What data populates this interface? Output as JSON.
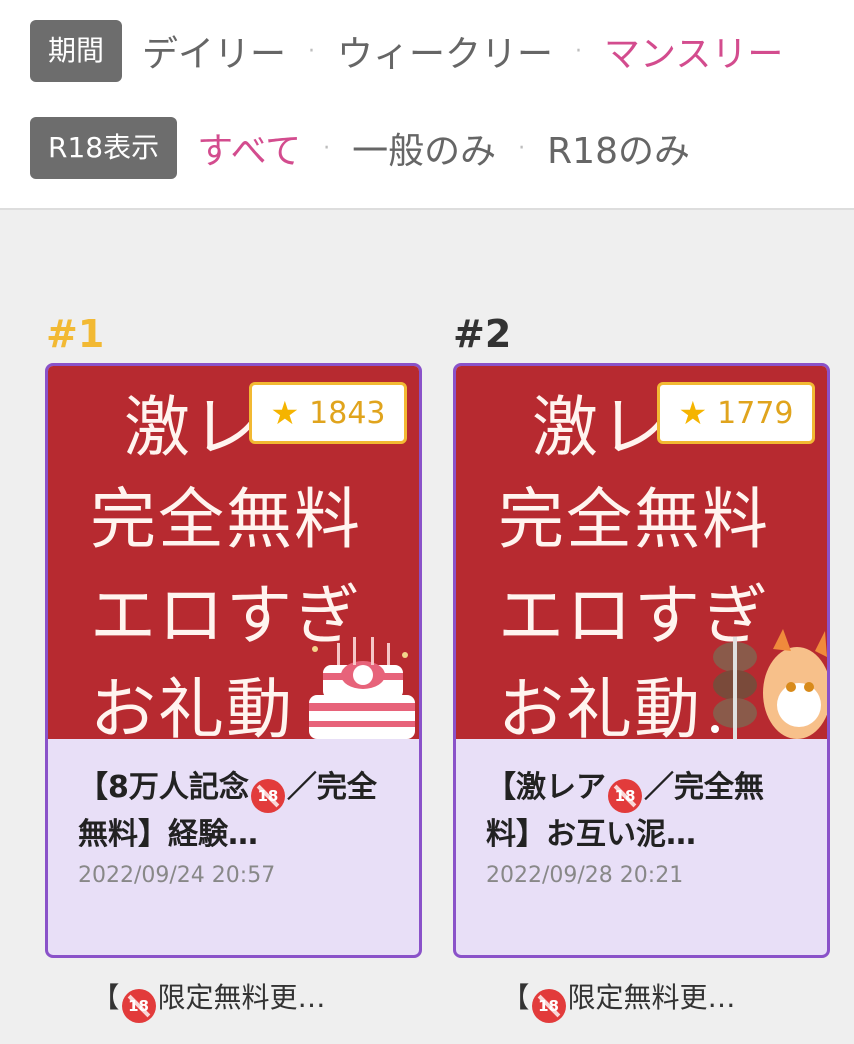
{
  "filters": {
    "period": {
      "label": "期間",
      "options": [
        {
          "text": "デイリー",
          "active": false
        },
        {
          "text": "ウィークリー",
          "active": false
        },
        {
          "text": "マンスリー",
          "active": true
        }
      ]
    },
    "r18": {
      "label": "R18表示",
      "options": [
        {
          "text": "すべて",
          "active": true
        },
        {
          "text": "一般のみ",
          "active": false
        },
        {
          "text": "R18のみ",
          "active": false
        }
      ]
    },
    "separator": "·"
  },
  "ranking": [
    {
      "rank": "#1",
      "thumbnail_lines": [
        "激レ",
        "完全無料",
        "エロすぎ",
        "お礼動"
      ],
      "stars": "1843",
      "title_prefix": "【8万人記念",
      "title_suffix": "／完全無料】経験…",
      "date": "2022/09/24 20:57",
      "caption_prefix": "【",
      "caption_suffix": "限定無料更…"
    },
    {
      "rank": "#2",
      "thumbnail_lines": [
        "激レ",
        "完全無料",
        "エロすぎ",
        "お礼動"
      ],
      "stars": "1779",
      "title_prefix": "【激レア",
      "title_suffix": "／完全無料】お互い泥…",
      "date": "2022/09/28 20:21",
      "caption_prefix": "【",
      "caption_suffix": "限定無料更…"
    }
  ],
  "icons": {
    "star": "star-icon",
    "r18": "no-under-18-icon"
  },
  "colors": {
    "active": "#d34c8e",
    "rank_first": "#f2b933",
    "card_border": "#8a52c9",
    "card_bg": "#e8dff7",
    "thumb_bg": "#b72a30"
  }
}
